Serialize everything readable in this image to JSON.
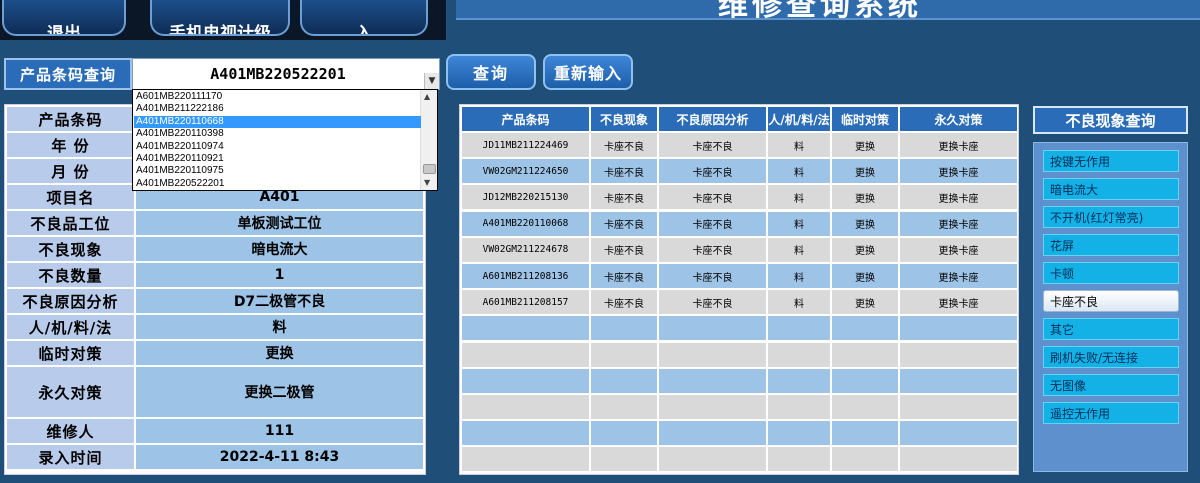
{
  "top": {
    "buttons": [
      "退出",
      "手机电视计级",
      "入"
    ],
    "title": "维修查询系统"
  },
  "query": {
    "label": "产品条码查询",
    "value": "A401MB220522201",
    "search_button": "查询",
    "reset_button": "重新输入"
  },
  "dropdown": {
    "items": [
      "A601MB220111170",
      "A401MB211222186",
      "A401MB220110668",
      "A401MB220110398",
      "A401MB220110974",
      "A401MB220110921",
      "A401MB220110975",
      "A401MB220522201"
    ],
    "selected_index": 2
  },
  "details": [
    {
      "label": "产品条码",
      "value": ""
    },
    {
      "label": "年 份",
      "value": ""
    },
    {
      "label": "月 份",
      "value": ""
    },
    {
      "label": "项目名",
      "value": "A401"
    },
    {
      "label": "不良品工位",
      "value": "单板测试工位"
    },
    {
      "label": "不良现象",
      "value": "暗电流大"
    },
    {
      "label": "不良数量",
      "value": "1"
    },
    {
      "label": "不良原因分析",
      "value": "D7二极管不良"
    },
    {
      "label": "人/机/料/法",
      "value": "料"
    },
    {
      "label": "临时对策",
      "value": "更换"
    },
    {
      "label": "永久对策",
      "value": "更换二极管"
    },
    {
      "label": "维修人",
      "value": "111"
    },
    {
      "label": "录入时间",
      "value": "2022-4-11  8:43"
    }
  ],
  "results": {
    "headers": [
      "产品条码",
      "不良现象",
      "不良原因分析",
      "人/机/料/法",
      "临时对策",
      "永久对策"
    ],
    "rows": [
      [
        "JD11MB211224469",
        "卡座不良",
        "卡座不良",
        "料",
        "更换",
        "更换卡座"
      ],
      [
        "VW02GM211224650",
        "卡座不良",
        "卡座不良",
        "料",
        "更换",
        "更换卡座"
      ],
      [
        "JD12MB220215130",
        "卡座不良",
        "卡座不良",
        "料",
        "更换",
        "更换卡座"
      ],
      [
        "A401MB220110068",
        "卡座不良",
        "卡座不良",
        "料",
        "更换",
        "更换卡座"
      ],
      [
        "VW02GM211224678",
        "卡座不良",
        "卡座不良",
        "料",
        "更换",
        "更换卡座"
      ],
      [
        "A601MB211208136",
        "卡座不良",
        "卡座不良",
        "料",
        "更换",
        "更换卡座"
      ],
      [
        "A601MB211208157",
        "卡座不良",
        "卡座不良",
        "料",
        "更换",
        "更换卡座"
      ]
    ],
    "empty_rows": 6
  },
  "defects": {
    "title": "不良现象查询",
    "items": [
      "按键无作用",
      "暗电流大",
      "不开机(红灯常亮)",
      "花屏",
      "卡顿",
      "卡座不良",
      "其它",
      "刷机失败/无连接",
      "无图像",
      "遥控无作用"
    ],
    "active_index": 5
  },
  "colors": {
    "background": "#1f4e79",
    "header_blue": "#2a6cb8",
    "label_cell": "#b8cbea",
    "value_cell": "#9dc3e6",
    "defect_button": "#13b1e6"
  }
}
